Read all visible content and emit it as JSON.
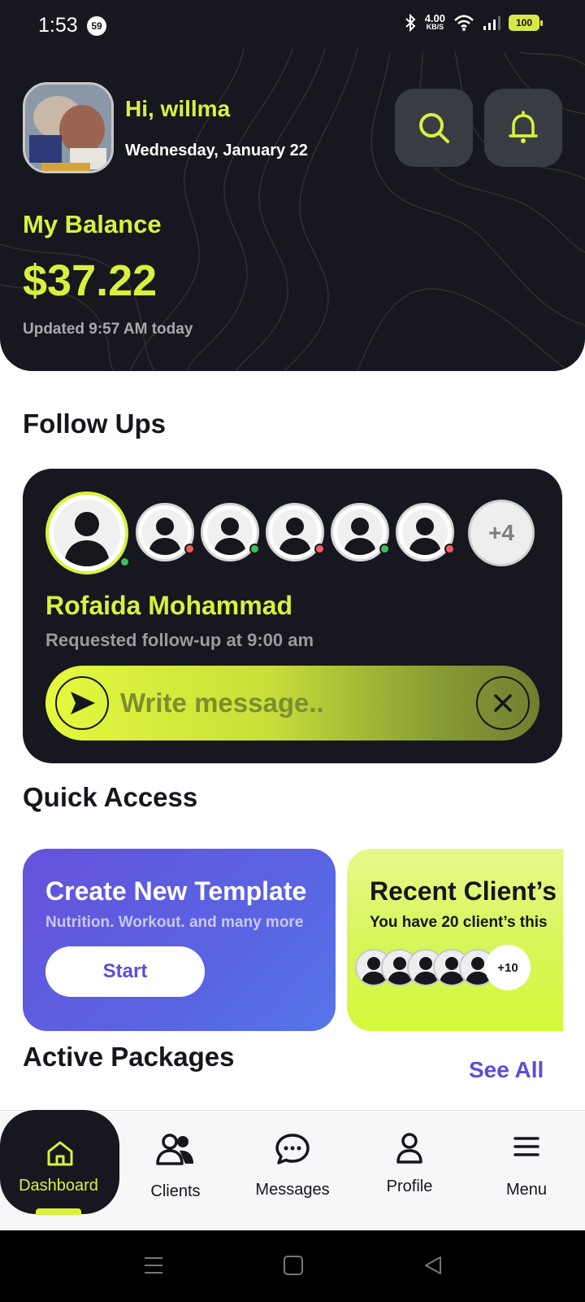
{
  "status_bar": {
    "time": "1:53",
    "notification_count": "59",
    "net_speed": "4.00",
    "net_unit": "KB/S",
    "battery": "100"
  },
  "header": {
    "greeting": "Hi, willma",
    "date": "Wednesday, January 22",
    "balance_label": "My Balance",
    "balance_value": "$37.22",
    "updated": "Updated 9:57 AM today"
  },
  "follow_ups": {
    "title": "Follow Ups",
    "avatar_statuses": [
      "green",
      "red",
      "green",
      "red",
      "green",
      "red"
    ],
    "more_count": "+4",
    "name": "Rofaida Mohammad",
    "request": "Requested follow-up at 9:00 am",
    "message_placeholder": "Write message.."
  },
  "quick_access": {
    "title": "Quick Access",
    "template_card": {
      "title": "Create New Template",
      "subtitle": "Nutrition. Workout. and many more",
      "button": "Start"
    },
    "recent_card": {
      "title": "Recent Client’s",
      "subtitle": "You have 20 client’s this",
      "more_count": "+10"
    }
  },
  "active_packages": {
    "title": "Active Packages",
    "see_all": "See All"
  },
  "bottom_nav": {
    "items": [
      {
        "label": "Dashboard",
        "icon": "home-icon",
        "active": true
      },
      {
        "label": "Clients",
        "icon": "users-icon",
        "active": false
      },
      {
        "label": "Messages",
        "icon": "chat-icon",
        "active": false
      },
      {
        "label": "Profile",
        "icon": "user-icon",
        "active": false
      },
      {
        "label": "Menu",
        "icon": "hamburger-icon",
        "active": false
      }
    ]
  },
  "colors": {
    "accent": "#d9f13d",
    "dark": "#17171f",
    "purple": "#5a4ed8"
  }
}
